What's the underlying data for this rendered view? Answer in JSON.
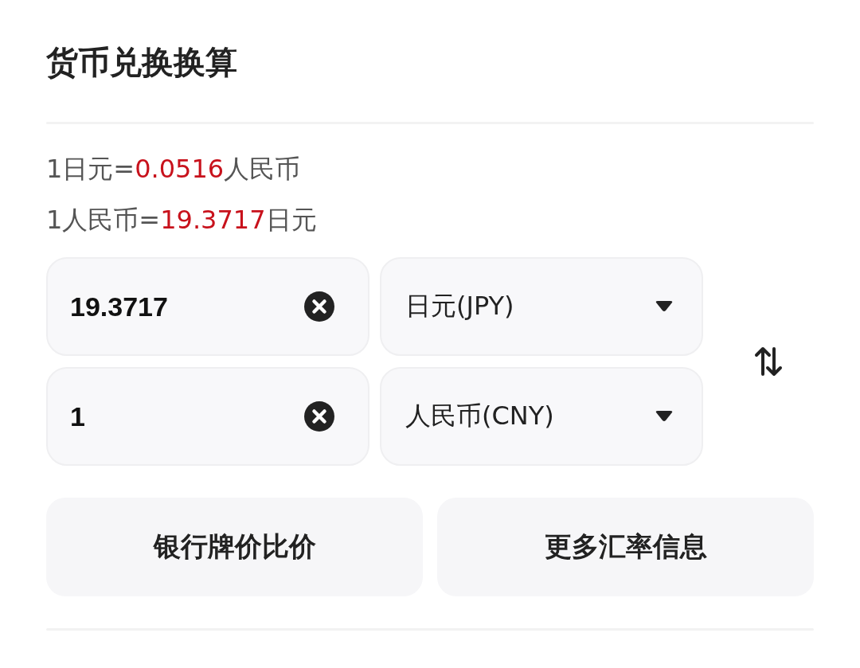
{
  "title": "货币兑换换算",
  "rates": [
    {
      "prefix": "1日元=",
      "value": "0.0516",
      "suffix": "人民币"
    },
    {
      "prefix": "1人民币=",
      "value": "19.3717",
      "suffix": "日元"
    }
  ],
  "converters": [
    {
      "amount": "19.3717",
      "currency": "日元(JPY)"
    },
    {
      "amount": "1",
      "currency": "人民币(CNY)"
    }
  ],
  "buttons": [
    "银行牌价比价",
    "更多汇率信息"
  ]
}
